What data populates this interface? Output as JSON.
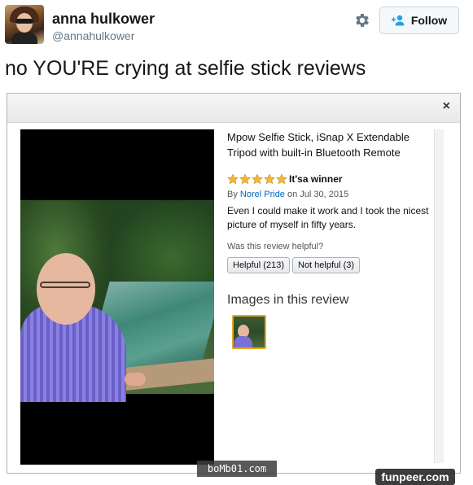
{
  "tweet": {
    "display_name": "anna hulkower",
    "handle": "@annahulkower",
    "follow_label": "Follow",
    "text": "no YOU'RE crying at selfie stick reviews"
  },
  "review": {
    "close_label": "×",
    "product_title": "Mpow Selfie Stick, iSnap X Extendable Tripod with built-in Bluetooth Remote",
    "rating_stars": 5,
    "review_title": "It'sa winner",
    "by_label": "By",
    "author": "Norel Pride",
    "date_label": "on Jul 30, 2015",
    "body": "Even I could make it work and I took the nicest picture of myself in fifty years.",
    "helpful_question": "Was this review helpful?",
    "helpful_button": "Helpful (213)",
    "not_helpful_button": "Not helpful (3)",
    "images_heading": "Images in this review"
  },
  "watermarks": {
    "bomb": "boMb01.com",
    "funpeer": "funpeer.com"
  },
  "colors": {
    "link_blue": "#0066c0",
    "star_gold": "#f7b731",
    "follow_icon": "#1da1f2"
  },
  "icons": {
    "settings": "gear-icon",
    "follow": "add-user-icon",
    "close": "close-icon",
    "star": "star-icon"
  }
}
